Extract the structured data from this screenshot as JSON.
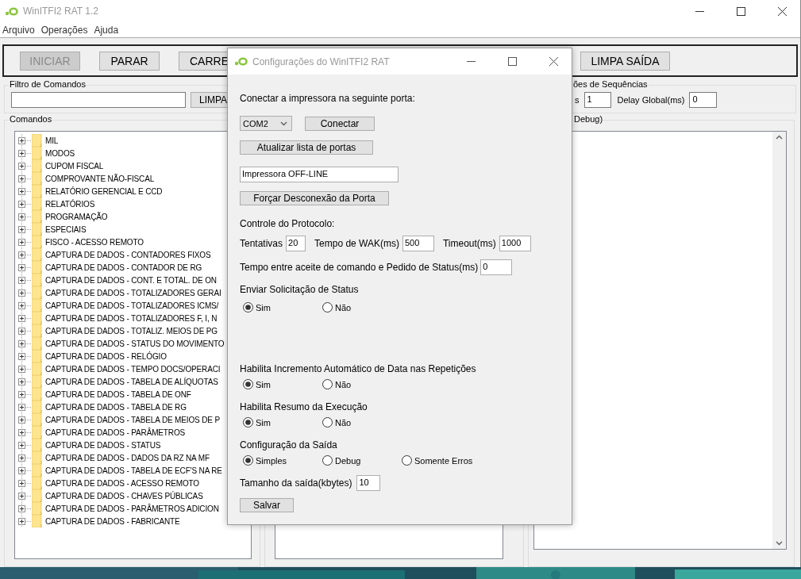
{
  "window": {
    "title": "WinITFI2 RAT 1.2"
  },
  "menu": [
    {
      "label": "Arquivo"
    },
    {
      "label": "Operações"
    },
    {
      "label": "Ajuda"
    }
  ],
  "toolbar": {
    "buttons": [
      {
        "label": "INICIAR",
        "disabled": true
      },
      {
        "label": "PARAR",
        "disabled": false
      },
      {
        "label": "CARRE",
        "disabled": false
      }
    ],
    "clear_output": {
      "label": "LIMPA SAÍDA",
      "disabled": false
    }
  },
  "filter": {
    "title": "Filtro de Comandos",
    "button": "LIMPA"
  },
  "sequences": {
    "title": "ões de Sequências",
    "fields": [
      {
        "label": "s",
        "value": "1"
      },
      {
        "label": "Delay Global(ms)",
        "value": "0"
      }
    ]
  },
  "commands": {
    "title": "Comandos",
    "items": [
      {
        "label": "MIL",
        "expanded": false
      },
      {
        "label": "MODOS",
        "expanded": false
      },
      {
        "label": "CUPOM FISCAL",
        "expanded": false
      },
      {
        "label": "COMPROVANTE NÃO-FISCAL",
        "expanded": false
      },
      {
        "label": "RELATÓRIO GERENCIAL E CCD",
        "expanded": false
      },
      {
        "label": "RELATÓRIOS",
        "expanded": false
      },
      {
        "label": "PROGRAMAÇÃO",
        "expanded": false
      },
      {
        "label": "ESPECIAIS",
        "expanded": false
      },
      {
        "label": "FISCO - ACESSO REMOTO",
        "expanded": false
      },
      {
        "label": "CAPTURA DE DADOS - CONTADORES FIXOS",
        "expanded": false
      },
      {
        "label": "CAPTURA DE DADOS - CONTADOR DE RG",
        "expanded": false
      },
      {
        "label": "CAPTURA DE DADOS - CONT. E TOTAL. DE ON",
        "expanded": false
      },
      {
        "label": "CAPTURA DE DADOS - TOTALIZADORES GERAI",
        "expanded": false
      },
      {
        "label": "CAPTURA DE DADOS - TOTALIZADORES ICMS/",
        "expanded": false
      },
      {
        "label": "CAPTURA DE DADOS - TOTALIZADORES F, I, N",
        "expanded": false
      },
      {
        "label": "CAPTURA DE DADOS - TOTALIZ. MEIOS DE PG",
        "expanded": false
      },
      {
        "label": "CAPTURA DE DADOS - STATUS DO MOVIMENTO",
        "expanded": false
      },
      {
        "label": "CAPTURA DE DADOS - RELÓGIO",
        "expanded": false
      },
      {
        "label": "CAPTURA DE DADOS - TEMPO DOCS/OPERACI",
        "expanded": false
      },
      {
        "label": "CAPTURA DE DADOS - TABELA DE ALÍQUOTAS",
        "expanded": false
      },
      {
        "label": "CAPTURA DE DADOS - TABELA DE ONF",
        "expanded": false
      },
      {
        "label": "CAPTURA DE DADOS - TABELA DE RG",
        "expanded": false
      },
      {
        "label": "CAPTURA DE DADOS - TABELA DE MEIOS DE P",
        "expanded": false
      },
      {
        "label": "CAPTURA DE DADOS - PARÂMETROS",
        "expanded": false
      },
      {
        "label": "CAPTURA DE DADOS - STATUS",
        "expanded": false
      },
      {
        "label": "CAPTURA DE DADOS - DADOS DA RZ NA MF",
        "expanded": false
      },
      {
        "label": "CAPTURA DE DADOS - TABELA DE ECF'S NA RE",
        "expanded": false
      },
      {
        "label": "CAPTURA DE DADOS - ACESSO REMOTO",
        "expanded": false
      },
      {
        "label": "CAPTURA DE DADOS - CHAVES PÚBLICAS",
        "expanded": false
      },
      {
        "label": "CAPTURA DE DADOS - PARÂMETROS ADICION",
        "expanded": false
      },
      {
        "label": "CAPTURA DE DADOS - FABRICANTE",
        "expanded": false
      }
    ]
  },
  "output": {
    "title": "Debug)"
  },
  "dialog": {
    "title": "Configurações do WinITFI2 RAT",
    "connect_label": "Conectar a impressora na seguinte porta:",
    "port": {
      "value": "COM2"
    },
    "connect_button": "Conectar",
    "refresh_button": "Atualizar lista de portas",
    "status": {
      "value": "Impressora OFF-LINE"
    },
    "disconnect_button": "Forçar Desconexão da Porta",
    "protocol_label": "Controle do Protocolo:",
    "protocol_fields": [
      {
        "label": "Tentativas",
        "value": "20"
      },
      {
        "label": "Tempo de WAK(ms)",
        "value": "500"
      },
      {
        "label": "Timeout(ms)",
        "value": "1000"
      }
    ],
    "status_delay": {
      "label": "Tempo entre aceite de comando e Pedido de Status(ms)",
      "value": "0"
    },
    "radio_groups": [
      {
        "label": "Enviar Solicitação de Status",
        "options": [
          {
            "label": "Sim",
            "selected": true
          },
          {
            "label": "Não",
            "selected": false
          }
        ]
      },
      {
        "label": "Habilita Incremento Automático de Data nas Repetições",
        "options": [
          {
            "label": "Sim",
            "selected": true
          },
          {
            "label": "Não",
            "selected": false
          }
        ]
      },
      {
        "label": "Habilita Resumo da Execução",
        "options": [
          {
            "label": "Sim",
            "selected": true
          },
          {
            "label": "Não",
            "selected": false
          }
        ]
      },
      {
        "label": "Configuração da Saída",
        "options": [
          {
            "label": "Simples",
            "selected": true
          },
          {
            "label": "Debug",
            "selected": false
          },
          {
            "label": "Somente Erros",
            "selected": false
          }
        ]
      }
    ],
    "output_size": {
      "label": "Tamanho da saída(kbytes)",
      "value": "10"
    },
    "save_button": "Salvar"
  }
}
